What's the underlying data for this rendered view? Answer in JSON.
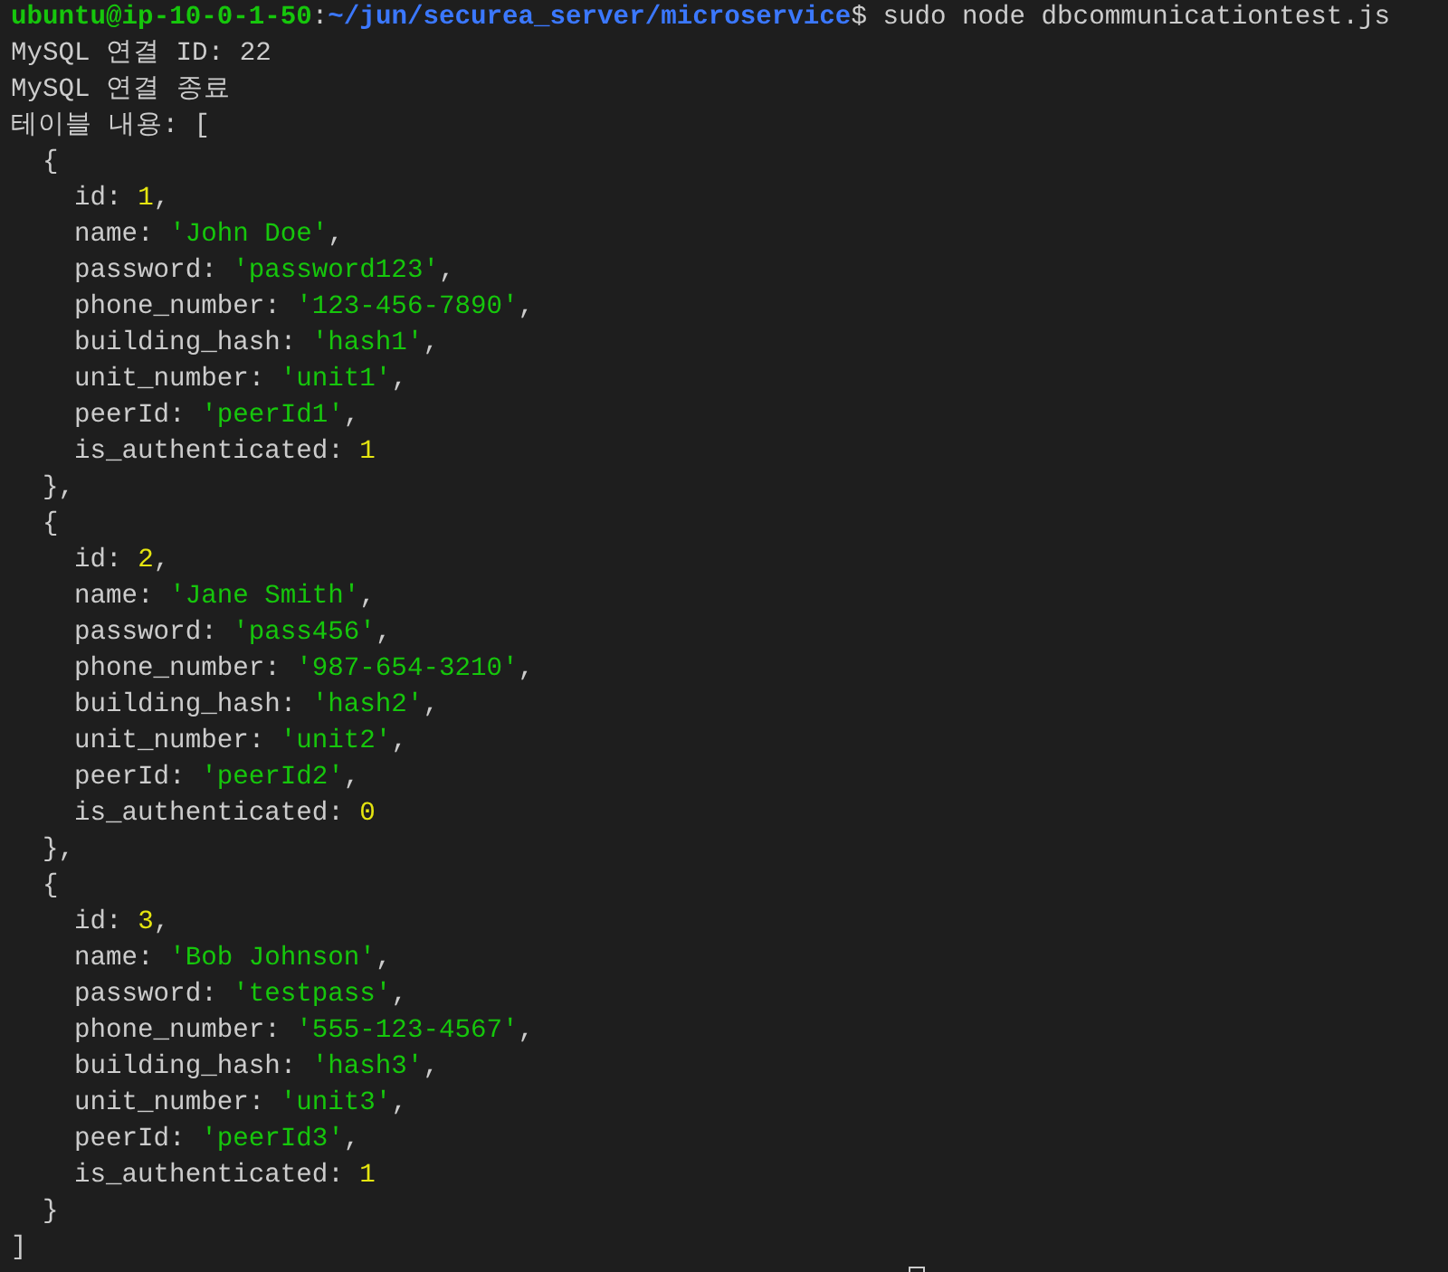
{
  "prompt": {
    "user_host": "ubuntu@ip-10-0-1-50",
    "separator": ":",
    "path": "~/jun/securea_server/microservice",
    "dollar": "$",
    "command": "sudo node dbcommunicationtest.js"
  },
  "output_lines": [
    "MySQL 연결 ID: 22",
    "MySQL 연결 종료"
  ],
  "table_label": "테이블 내용:",
  "array_open": "[",
  "records": [
    {
      "open": "{",
      "close": "},",
      "fields": [
        {
          "key": "id:",
          "value": "1",
          "kind": "number",
          "suffix": ","
        },
        {
          "key": "name:",
          "value": "'John Doe'",
          "kind": "string",
          "suffix": ","
        },
        {
          "key": "password:",
          "value": "'password123'",
          "kind": "string",
          "suffix": ","
        },
        {
          "key": "phone_number:",
          "value": "'123-456-7890'",
          "kind": "string",
          "suffix": ","
        },
        {
          "key": "building_hash:",
          "value": "'hash1'",
          "kind": "string",
          "suffix": ","
        },
        {
          "key": "unit_number:",
          "value": "'unit1'",
          "kind": "string",
          "suffix": ","
        },
        {
          "key": "peerId:",
          "value": "'peerId1'",
          "kind": "string",
          "suffix": ","
        },
        {
          "key": "is_authenticated:",
          "value": "1",
          "kind": "number"
        }
      ]
    },
    {
      "open": "{",
      "close": "},",
      "fields": [
        {
          "key": "id:",
          "value": "2",
          "kind": "number",
          "suffix": ","
        },
        {
          "key": "name:",
          "value": "'Jane Smith'",
          "kind": "string",
          "suffix": ","
        },
        {
          "key": "password:",
          "value": "'pass456'",
          "kind": "string",
          "suffix": ","
        },
        {
          "key": "phone_number:",
          "value": "'987-654-3210'",
          "kind": "string",
          "suffix": ","
        },
        {
          "key": "building_hash:",
          "value": "'hash2'",
          "kind": "string",
          "suffix": ","
        },
        {
          "key": "unit_number:",
          "value": "'unit2'",
          "kind": "string",
          "suffix": ","
        },
        {
          "key": "peerId:",
          "value": "'peerId2'",
          "kind": "string",
          "suffix": ","
        },
        {
          "key": "is_authenticated:",
          "value": "0",
          "kind": "number"
        }
      ]
    },
    {
      "open": "{",
      "close": "}",
      "fields": [
        {
          "key": "id:",
          "value": "3",
          "kind": "number",
          "suffix": ","
        },
        {
          "key": "name:",
          "value": "'Bob Johnson'",
          "kind": "string",
          "suffix": ","
        },
        {
          "key": "password:",
          "value": "'testpass'",
          "kind": "string",
          "suffix": ","
        },
        {
          "key": "phone_number:",
          "value": "'555-123-4567'",
          "kind": "string",
          "suffix": ","
        },
        {
          "key": "building_hash:",
          "value": "'hash3'",
          "kind": "string",
          "suffix": ","
        },
        {
          "key": "unit_number:",
          "value": "'unit3'",
          "kind": "string",
          "suffix": ","
        },
        {
          "key": "peerId:",
          "value": "'peerId3'",
          "kind": "string",
          "suffix": ","
        },
        {
          "key": "is_authenticated:",
          "value": "1",
          "kind": "number"
        }
      ]
    }
  ],
  "array_close": "]"
}
